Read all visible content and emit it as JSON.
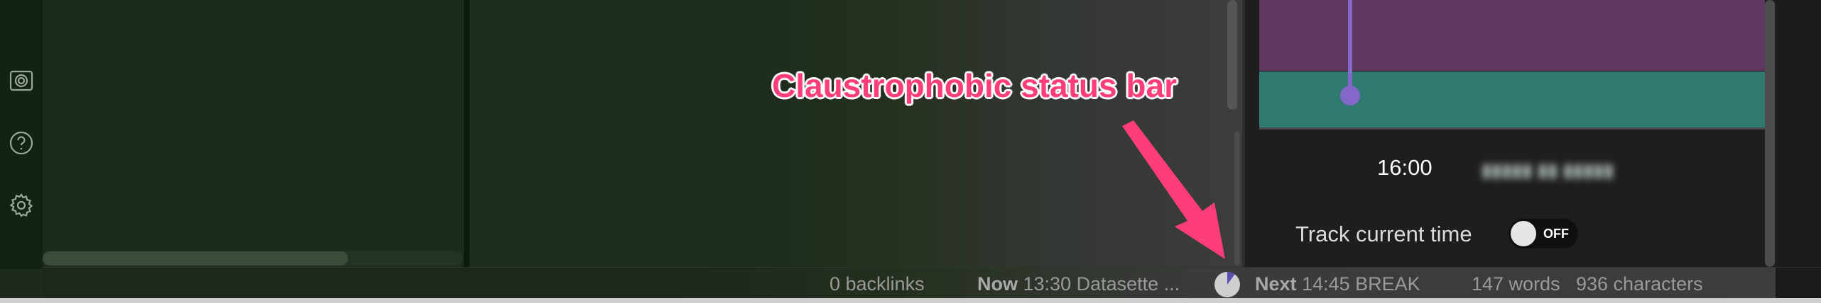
{
  "ribbon": {
    "icons": [
      "graph-icon",
      "help-icon",
      "settings-icon"
    ]
  },
  "calendar": {
    "time_label": "16:00",
    "blurred_event_text": "▮▮▮▮▮ ▮▮ ▮▮▮▮▮",
    "event_colors": {
      "purple": "#5e3861",
      "teal": "#307a72",
      "now_line": "#8468c9"
    }
  },
  "track_current_time": {
    "label": "Track current time",
    "toggle_state": "OFF"
  },
  "status_bar": {
    "backlinks": "0 backlinks",
    "now_label": "Now",
    "now_value": "13:30 Datasette ...",
    "next_label": "Next",
    "next_value": "14:45 BREAK",
    "progress_fraction": 0.1,
    "words": "147 words",
    "characters": "936 characters"
  },
  "annotation": {
    "text": "Claustrophobic status bar",
    "color": "#ff3d79"
  }
}
